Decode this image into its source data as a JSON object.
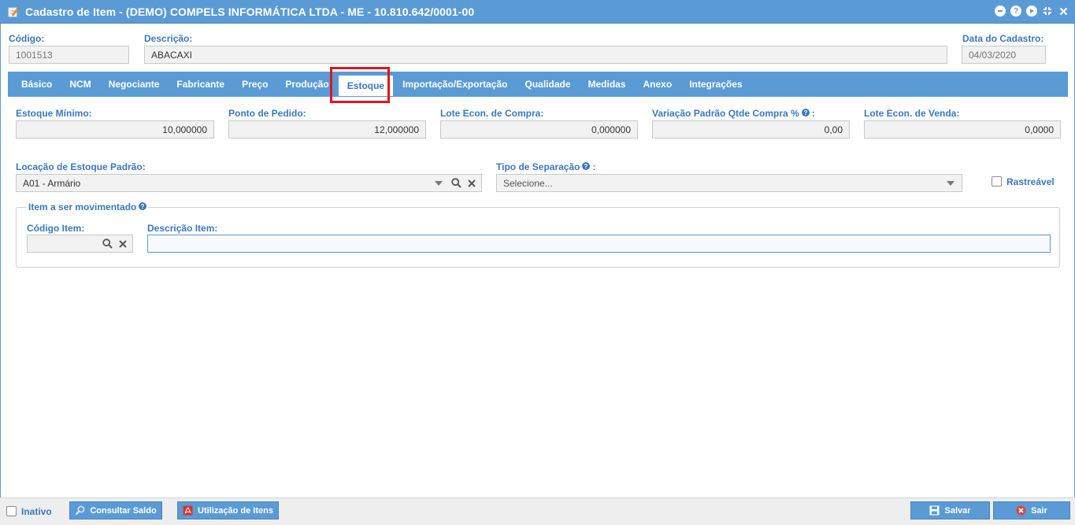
{
  "window": {
    "title": "Cadastro de Item - (DEMO) COMPELS INFORMÁTICA LTDA - ME - 10.810.642/0001-00",
    "controls": {
      "minimize": "–",
      "help": "?",
      "play": "▸",
      "collapse": "⇲",
      "close": "✕"
    }
  },
  "header": {
    "codigo": {
      "label": "Código:",
      "value": "1001513"
    },
    "descricao": {
      "label": "Descrição:",
      "value": "ABACAXI"
    },
    "data_cadastro": {
      "label": "Data do Cadastro:",
      "value": "04/03/2020"
    }
  },
  "tabs": [
    {
      "label": "Básico"
    },
    {
      "label": "NCM"
    },
    {
      "label": "Negociante"
    },
    {
      "label": "Fabricante"
    },
    {
      "label": "Preço"
    },
    {
      "label": "Produção"
    },
    {
      "label": "Estoque",
      "active": true
    },
    {
      "label": "Importação/Exportação"
    },
    {
      "label": "Qualidade"
    },
    {
      "label": "Medidas"
    },
    {
      "label": "Anexo"
    },
    {
      "label": "Integrações"
    }
  ],
  "estoque": {
    "estoque_minimo": {
      "label": "Estoque Mínimo:",
      "value": "10,000000"
    },
    "ponto_pedido": {
      "label": "Ponto de Pedido:",
      "value": "12,000000"
    },
    "lote_compra": {
      "label": "Lote Econ. de Compra:",
      "value": "0,000000"
    },
    "variacao": {
      "label": "Variação Padrão Qtde Compra %",
      "suffix": ":",
      "value": "0,00"
    },
    "lote_venda": {
      "label": "Lote Econ. de Venda:",
      "value": "0,0000"
    },
    "locacao": {
      "label": "Locação de Estoque Padrão:",
      "value": "A01 - Armário"
    },
    "tipo_separacao": {
      "label": "Tipo de Separação",
      "suffix": ":",
      "placeholder": "Selecione..."
    },
    "rastreavel": {
      "label": "Rastreável",
      "checked": false
    }
  },
  "item_movimentado": {
    "legend": "Item a ser movimentado",
    "codigo_item": {
      "label": "Código Item:",
      "value": ""
    },
    "descricao_item": {
      "label": "Descrição Item:",
      "value": ""
    }
  },
  "footer": {
    "inativo": {
      "label": "Inativo",
      "checked": false
    },
    "consultar_saldo": "Consultar Saldo",
    "utilizacao_itens": "Utilização de Itens",
    "salvar": "Salvar",
    "sair": "Sair"
  },
  "colors": {
    "accent": "#5b9bd5",
    "label": "#3a78c2",
    "highlight": "#e3141b"
  }
}
